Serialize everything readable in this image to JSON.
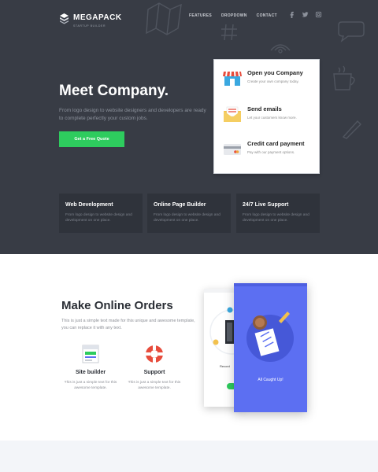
{
  "brand": {
    "name": "MEGAPACK",
    "tagline": "STARTUP BUILDER"
  },
  "nav": {
    "items": [
      "FEATURES",
      "DROPDOWN",
      "CONTACT"
    ]
  },
  "social": [
    "facebook-icon",
    "twitter-icon",
    "instagram-icon"
  ],
  "hero": {
    "title": "Meet Company.",
    "text": "From logo design to website designers and developers are ready to complete perfectly your custom jobs.",
    "button": "Get a Free Quote"
  },
  "features": [
    {
      "title": "Open you Company",
      "sub": "Create your own company today.",
      "icon": "store-icon"
    },
    {
      "title": "Send emails",
      "sub": "Let your customers know more.",
      "icon": "envelope-icon"
    },
    {
      "title": "Credit card payment",
      "sub": "Pay with our payment options.",
      "icon": "credit-card-icon"
    }
  ],
  "boxes": [
    {
      "title": "Web Development",
      "text": "From logo design to website design and development on one place."
    },
    {
      "title": "Online Page Builder",
      "text": "From logo design to website design and development on one place."
    },
    {
      "title": "24/7 Live Support",
      "text": "From logo design to website design and development on one place."
    }
  ],
  "orders": {
    "title": "Make Online Orders",
    "text": "This is just a simple text made for this unique and awesome template, you can replace it with any text.",
    "services": [
      {
        "title": "Site builder",
        "text": "This is just a simple text for this awesome template.",
        "icon": "site-builder-icon"
      },
      {
        "title": "Support",
        "text": "This is just a simple text for this awesome template.",
        "icon": "lifebuoy-icon"
      }
    ]
  },
  "mockup": {
    "caught_up": "All Caught Up!",
    "record": "Record"
  },
  "colors": {
    "hero_bg": "#383c45",
    "accent": "#2ecc5e",
    "box_bg": "#2f333b",
    "phone_blue": "#5c6ff2"
  }
}
